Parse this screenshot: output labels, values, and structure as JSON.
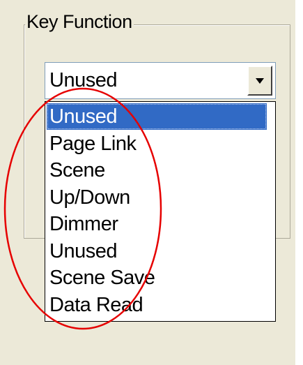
{
  "key_function": {
    "legend": "Key Function",
    "selected_value": "Unused",
    "options": [
      "Unused",
      "Page Link",
      "Scene",
      "Up/Down",
      "Dimmer",
      "Unused",
      "Scene Save",
      "Data Read"
    ],
    "highlighted_index": 0
  },
  "annotation": {
    "color": "#e60000",
    "shape": "ellipse"
  },
  "colors": {
    "window_bg": "#ece9d8",
    "highlight": "#316ac5"
  },
  "icons": {
    "dropdown_arrow": "chevron-down-icon"
  }
}
